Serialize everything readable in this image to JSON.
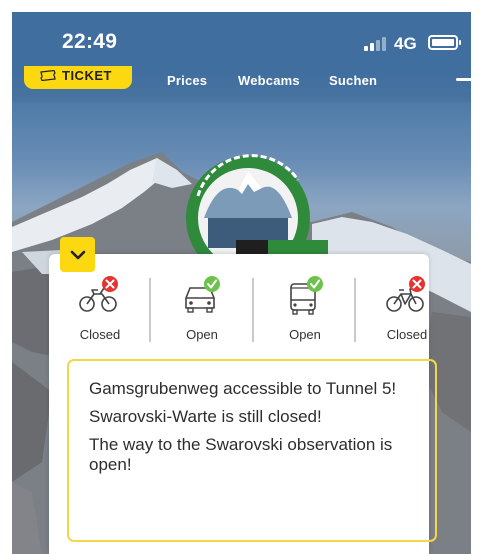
{
  "status_bar": {
    "time": "22:49",
    "network": "4G"
  },
  "nav": {
    "ticket_label": "TICKET",
    "links": [
      "Prices",
      "Webcams",
      "Suchen"
    ]
  },
  "road_status": {
    "modes": [
      {
        "icon": "motorcycle-icon",
        "status_icon": "closed-x-badge",
        "label": "Closed"
      },
      {
        "icon": "car-icon",
        "status_icon": "open-check-badge",
        "label": "Open"
      },
      {
        "icon": "bus-icon",
        "status_icon": "open-check-badge",
        "label": "Open"
      },
      {
        "icon": "bicycle-icon",
        "status_icon": "closed-x-badge",
        "label": "Closed"
      }
    ]
  },
  "notice": {
    "lines": [
      "Gamsgrubenweg accessible to Tunnel 5!",
      "Swarovski-Warte is still closed!",
      "The way to the Swarovski observation is open!"
    ]
  },
  "colors": {
    "accent_yellow": "#fbd80f",
    "open_green": "#6cc24a",
    "closed_red": "#e3342f",
    "notice_border": "#f3d64a"
  }
}
